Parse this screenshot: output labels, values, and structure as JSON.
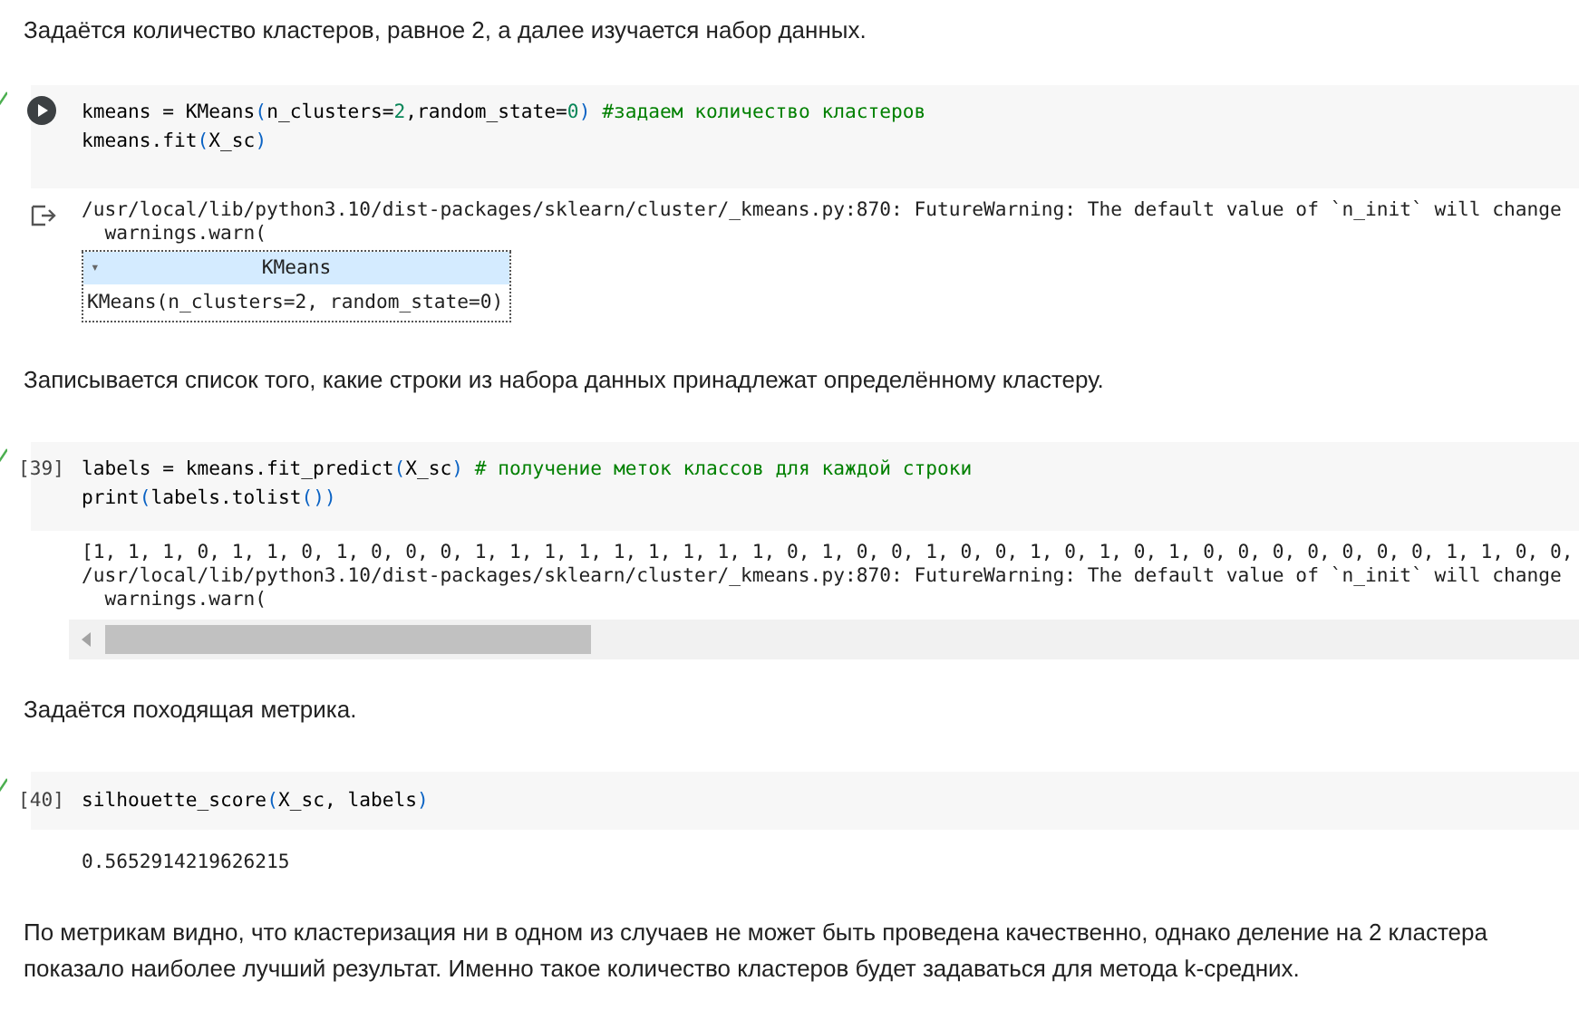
{
  "blocks": [
    {
      "kind": "text",
      "text": "Задаётся количество кластеров, равное 2, а далее изучается набор данных."
    },
    {
      "kind": "code",
      "gutter": {
        "kind": "run"
      },
      "code": [
        "kmeans = KMeans(n_clusters=2,random_state=0) #задаем количество кластеров",
        "kmeans.fit(X_sc)"
      ],
      "output": {
        "icon": true,
        "lines": [
          "/usr/local/lib/python3.10/dist-packages/sklearn/cluster/_kmeans.py:870: FutureWarning: The default value of `n_init` will change",
          "  warnings.warn("
        ],
        "widget": {
          "toggle": "▾",
          "title": "KMeans",
          "body": "KMeans(n_clusters=2, random_state=0)"
        },
        "scrollbar": false
      }
    },
    {
      "kind": "text",
      "text": "Записывается список того, какие строки из набора данных принадлежат определённому кластеру."
    },
    {
      "kind": "code",
      "gutter": {
        "kind": "count",
        "text": "[39]"
      },
      "code": [
        "labels = kmeans.fit_predict(X_sc) # получение меток классов для каждой строки",
        "print(labels.tolist())"
      ],
      "output": {
        "icon": false,
        "lines": [
          "[1, 1, 1, 0, 1, 1, 0, 1, 0, 0, 0, 1, 1, 1, 1, 1, 1, 1, 1, 1, 0, 1, 0, 0, 1, 0, 0, 1, 0, 1, 0, 1, 0, 0, 0, 0, 0, 0, 0, 1, 1, 0, 0,",
          "/usr/local/lib/python3.10/dist-packages/sklearn/cluster/_kmeans.py:870: FutureWarning: The default value of `n_init` will change",
          "  warnings.warn("
        ],
        "scrollbar": true
      }
    },
    {
      "kind": "text",
      "text": "Задаётся походящая метрика."
    },
    {
      "kind": "code",
      "gutter": {
        "kind": "count",
        "text": "[40]"
      },
      "code": [
        "silhouette_score(X_sc, labels)"
      ],
      "output": {
        "icon": false,
        "lines": [
          "0.5652914219626215"
        ],
        "scrollbar": false
      }
    },
    {
      "kind": "text",
      "text": "По метрикам видно, что кластеризация ни в одном из случаев не может быть проведена качественно, однако деление на 2 кластера показало наиболее лучший результат. Именно такое количество кластеров будет задаваться для метода k-средних."
    }
  ]
}
